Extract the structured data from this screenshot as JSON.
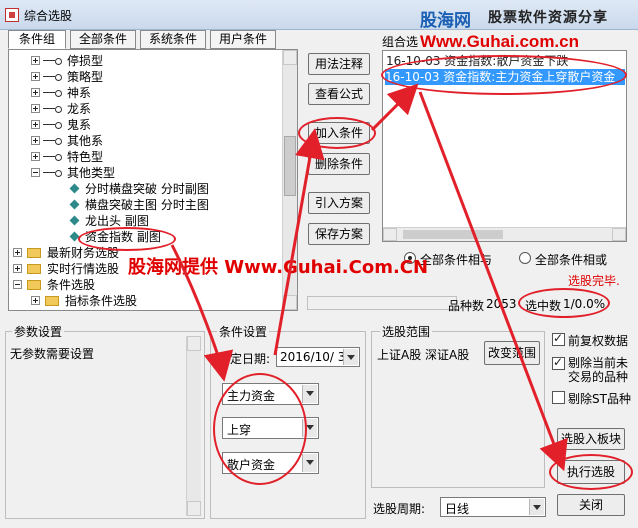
{
  "window": {
    "title": "综合选股"
  },
  "watermark": {
    "logo": "股海网",
    "slogan": "股票软件资源分享",
    "url": "Www.Guhai.com.cn",
    "overlay": "股海网提供 Www.Guhai.Com.CN"
  },
  "tabs": [
    {
      "label": "条件组"
    },
    {
      "label": "全部条件"
    },
    {
      "label": "系统条件"
    },
    {
      "label": "用户条件"
    }
  ],
  "tree": {
    "items": [
      {
        "label": "停损型"
      },
      {
        "label": "策略型"
      },
      {
        "label": "神系"
      },
      {
        "label": "龙系"
      },
      {
        "label": "鬼系"
      },
      {
        "label": "其他系"
      },
      {
        "label": "特色型"
      },
      {
        "label": "其他类型"
      },
      {
        "label": "分时横盘突破 分时副图"
      },
      {
        "label": "横盘突破主图 分时主图"
      },
      {
        "label": "龙出头 副图"
      },
      {
        "label": "资金指数 副图"
      },
      {
        "label": "最新财务选股"
      },
      {
        "label": "实时行情选股"
      },
      {
        "label": "条件选股"
      },
      {
        "label": "指标条件选股"
      }
    ]
  },
  "mid_buttons": {
    "usage": "用法注释",
    "formula": "查看公式",
    "add": "加入条件",
    "delete": "删除条件",
    "import": "引入方案",
    "save": "保存方案"
  },
  "combo_section": {
    "label": "组合选",
    "items": [
      {
        "text": "16-10-03 资金指数:散户资金下跌"
      },
      {
        "text": "16-10-03 资金指数:主力资金上穿散户资金"
      }
    ]
  },
  "logic": {
    "all_and": "全部条件相与",
    "all_or": "全部条件相或"
  },
  "status": {
    "done": "选股完毕.",
    "count_label": "品种数",
    "count_value": "2053",
    "selected_label": "选中数",
    "selected_value": "1/0.0%"
  },
  "params": {
    "title": "参数设置",
    "none": "无参数需要设置"
  },
  "condition": {
    "title": "条件设置",
    "date_label": "指定日期:",
    "date_value": "2016/10/ 3",
    "field1": "主力资金",
    "operator": "上穿",
    "field2": "散户资金"
  },
  "range": {
    "title": "选股范围",
    "markets": "上证A股 深证A股",
    "change": "改变范围"
  },
  "options": {
    "fuquan": "前复权数据",
    "exclude_suspended": "剔除当前未交易的品种",
    "exclude_st": "剔除ST品种"
  },
  "actions": {
    "to_block": "选股入板块",
    "execute": "执行选股",
    "close": "关闭"
  },
  "period": {
    "label": "选股周期:",
    "value": "日线"
  }
}
